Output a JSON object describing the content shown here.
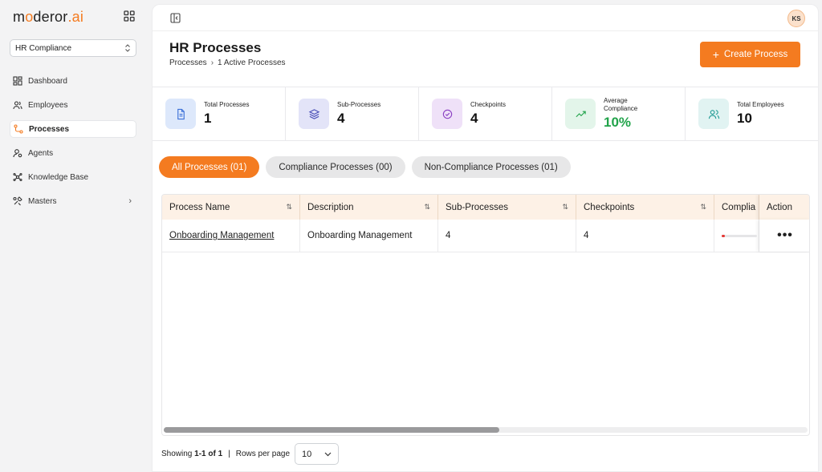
{
  "brand": {
    "logo_pre": "m",
    "logo_o": "o",
    "logo_mid": "deror",
    "logo_dot": ".",
    "logo_ai": "ai",
    "accent": "#f47b20"
  },
  "sidebar": {
    "org": "HR Compliance",
    "items": [
      {
        "label": "Dashboard",
        "icon": "dashboard-icon"
      },
      {
        "label": "Employees",
        "icon": "users-icon"
      },
      {
        "label": "Processes",
        "icon": "process-icon",
        "active": true
      },
      {
        "label": "Agents",
        "icon": "agent-icon"
      },
      {
        "label": "Knowledge Base",
        "icon": "knowledge-icon"
      },
      {
        "label": "Masters",
        "icon": "masters-icon",
        "has_children": true
      }
    ]
  },
  "header": {
    "avatar": "KS"
  },
  "page": {
    "title": "HR Processes",
    "breadcrumb": [
      "Processes",
      "1 Active Processes"
    ],
    "create_label": "Create Process"
  },
  "stats": [
    {
      "label": "Total Processes",
      "value": "1",
      "icon": "document-icon",
      "bg": "#dde8fb",
      "fg": "#3b6fd8"
    },
    {
      "label": "Sub-Processes",
      "value": "4",
      "icon": "layers-icon",
      "bg": "#e3e4f8",
      "fg": "#4b50b8"
    },
    {
      "label": "Checkpoints",
      "value": "4",
      "icon": "check-circle-icon",
      "bg": "#efe1f8",
      "fg": "#8a3fc2"
    },
    {
      "label": "Average Compliance",
      "value": "10%",
      "icon": "trend-up-icon",
      "bg": "#e3f5ea",
      "fg": "#21a34a"
    },
    {
      "label": "Total Employees",
      "value": "10",
      "icon": "users-icon",
      "bg": "#e1f3f2",
      "fg": "#1f9a93"
    }
  ],
  "tabs": [
    {
      "label": "All Processes (01)",
      "active": true
    },
    {
      "label": "Compliance Processes (00)"
    },
    {
      "label": "Non-Compliance Processes (01)"
    }
  ],
  "table": {
    "columns": [
      "Process Name",
      "Description",
      "Sub-Processes",
      "Checkpoints",
      "Complia",
      "Action"
    ],
    "rows": [
      {
        "name": "Onboarding Management",
        "description": "Onboarding Management",
        "sub_processes": "4",
        "checkpoints": "4",
        "compliance_fraction": 0.1,
        "action": "•••"
      }
    ]
  },
  "footer": {
    "showing_prefix": "Showing",
    "showing_range": "1-1 of 1",
    "pipe": "|",
    "rows_label": "Rows per page",
    "rows_value": "10"
  }
}
